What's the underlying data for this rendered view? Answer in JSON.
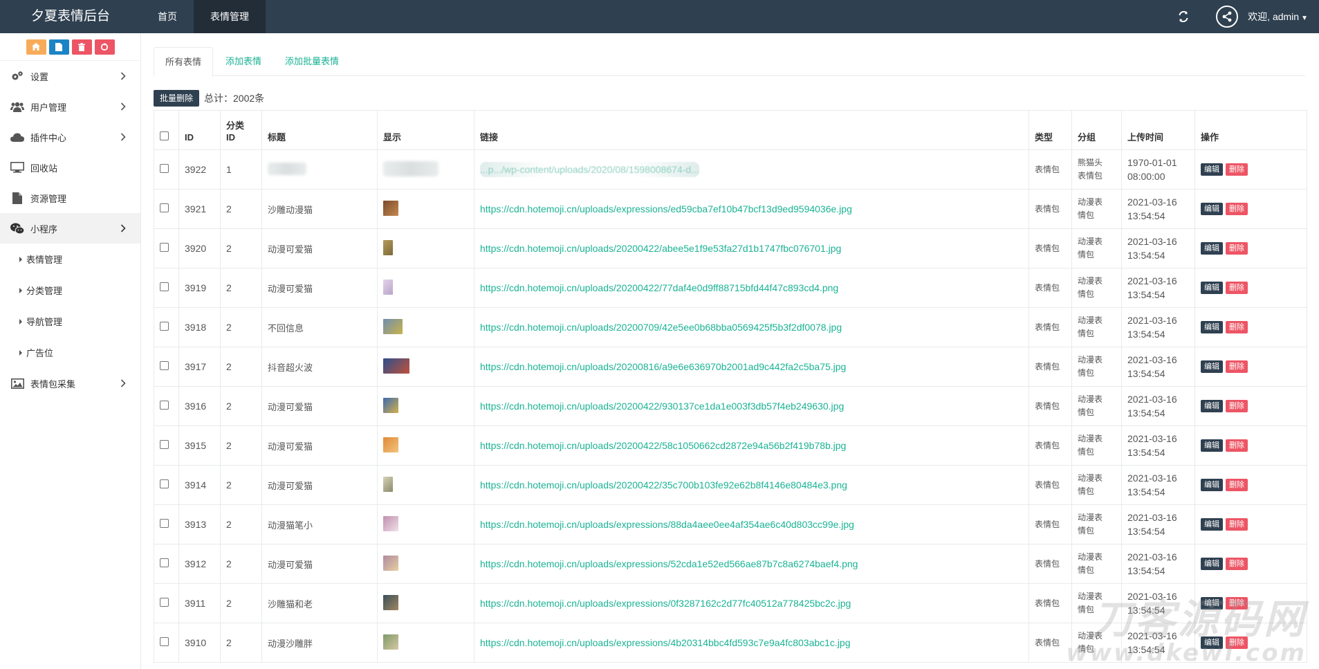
{
  "app": {
    "title": "夕夏表情后台"
  },
  "topnav": [
    {
      "label": "首页",
      "active": false
    },
    {
      "label": "表情管理",
      "active": true
    }
  ],
  "user": {
    "welcome": "欢迎, admin"
  },
  "quickbar": [
    {
      "icon": "home-icon",
      "color": "#f8ac59"
    },
    {
      "icon": "document-icon",
      "color": "#1c84c6"
    },
    {
      "icon": "trash-icon",
      "color": "#ed5565"
    },
    {
      "icon": "recycle-icon",
      "color": "#ed5565"
    }
  ],
  "sidebar": {
    "items": [
      {
        "label": "设置",
        "icon": "gears-icon"
      },
      {
        "label": "用户管理",
        "icon": "users-icon"
      },
      {
        "label": "插件中心",
        "icon": "cloud-icon"
      },
      {
        "label": "回收站",
        "icon": "monitor-icon"
      },
      {
        "label": "资源管理",
        "icon": "file-icon"
      },
      {
        "label": "小程序",
        "icon": "wechat-icon"
      }
    ],
    "subitems": [
      "表情管理",
      "分类管理",
      "导航管理",
      "广告位"
    ],
    "last_item": {
      "label": "表情包采集",
      "icon": "image-icon"
    }
  },
  "tabs": [
    "所有表情",
    "添加表情",
    "添加批量表情"
  ],
  "toolbar": {
    "bulk_delete": "批量删除",
    "total": "总计：2002条"
  },
  "table": {
    "headers": {
      "id": "ID",
      "cat_id_1": "分类",
      "cat_id_2": "ID",
      "title": "标题",
      "display": "显示",
      "link": "链接",
      "type": "类型",
      "group": "分组",
      "upload_time": "上传时间",
      "actions": "操作"
    },
    "edit_label": "编辑",
    "delete_label": "删除",
    "rows": [
      {
        "id": "3922",
        "cat": "1",
        "title": "",
        "link": "...p.../wp-content/uploads/2020/08/1598008674-d...",
        "type": "表情包",
        "group1": "熊猫头",
        "group2": "表情包",
        "date": "1970-01-01",
        "time": "08:00:00"
      },
      {
        "id": "3921",
        "cat": "2",
        "title": "沙雕动漫猫",
        "link": "https://cdn.hotemoji.cn/uploads/expressions/ed59cba7ef10b47bcf13d9ed9594036e.jpg",
        "type": "表情包",
        "group1": "动漫表",
        "group2": "情包",
        "date": "2021-03-16",
        "time": "13:54:54"
      },
      {
        "id": "3920",
        "cat": "2",
        "title": "动漫可爱猫",
        "link": "https://cdn.hotemoji.cn/uploads/20200422/abee5e1f9e53fa27d1b1747fbc076701.jpg",
        "type": "表情包",
        "group1": "动漫表",
        "group2": "情包",
        "date": "2021-03-16",
        "time": "13:54:54"
      },
      {
        "id": "3919",
        "cat": "2",
        "title": "动漫可爱猫",
        "link": "https://cdn.hotemoji.cn/uploads/20200422/77daf4e0d9ff88715bfd44f47c893cd4.png",
        "type": "表情包",
        "group1": "动漫表",
        "group2": "情包",
        "date": "2021-03-16",
        "time": "13:54:54"
      },
      {
        "id": "3918",
        "cat": "2",
        "title": "不回信息",
        "link": "https://cdn.hotemoji.cn/uploads/20200709/42e5ee0b68bba0569425f5b3f2df0078.jpg",
        "type": "表情包",
        "group1": "动漫表",
        "group2": "情包",
        "date": "2021-03-16",
        "time": "13:54:54"
      },
      {
        "id": "3917",
        "cat": "2",
        "title": "抖音超火波",
        "link": "https://cdn.hotemoji.cn/uploads/20200816/a9e6e636970b2001ad9c442fa2c5ba75.jpg",
        "type": "表情包",
        "group1": "动漫表",
        "group2": "情包",
        "date": "2021-03-16",
        "time": "13:54:54"
      },
      {
        "id": "3916",
        "cat": "2",
        "title": "动漫可爱猫",
        "link": "https://cdn.hotemoji.cn/uploads/20200422/930137ce1da1e003f3db57f4eb249630.jpg",
        "type": "表情包",
        "group1": "动漫表",
        "group2": "情包",
        "date": "2021-03-16",
        "time": "13:54:54"
      },
      {
        "id": "3915",
        "cat": "2",
        "title": "动漫可爱猫",
        "link": "https://cdn.hotemoji.cn/uploads/20200422/58c1050662cd2872e94a56b2f419b78b.jpg",
        "type": "表情包",
        "group1": "动漫表",
        "group2": "情包",
        "date": "2021-03-16",
        "time": "13:54:54"
      },
      {
        "id": "3914",
        "cat": "2",
        "title": "动漫可爱猫",
        "link": "https://cdn.hotemoji.cn/uploads/20200422/35c700b103fe92e62b8f4146e80484e3.png",
        "type": "表情包",
        "group1": "动漫表",
        "group2": "情包",
        "date": "2021-03-16",
        "time": "13:54:54"
      },
      {
        "id": "3913",
        "cat": "2",
        "title": "动漫猫笔小",
        "link": "https://cdn.hotemoji.cn/uploads/expressions/88da4aee0ee4af354ae6c40d803cc99e.jpg",
        "type": "表情包",
        "group1": "动漫表",
        "group2": "情包",
        "date": "2021-03-16",
        "time": "13:54:54"
      },
      {
        "id": "3912",
        "cat": "2",
        "title": "动漫可爱猫",
        "link": "https://cdn.hotemoji.cn/uploads/expressions/52cda1e52ed566ae87b7c8a6274baef4.png",
        "type": "表情包",
        "group1": "动漫表",
        "group2": "情包",
        "date": "2021-03-16",
        "time": "13:54:54"
      },
      {
        "id": "3911",
        "cat": "2",
        "title": "沙雕猫和老",
        "link": "https://cdn.hotemoji.cn/uploads/expressions/0f3287162c2d77fc40512a778425bc2c.jpg",
        "type": "表情包",
        "group1": "动漫表",
        "group2": "情包",
        "date": "2021-03-16",
        "time": "13:54:54"
      },
      {
        "id": "3910",
        "cat": "2",
        "title": "动漫沙雕胖",
        "link": "https://cdn.hotemoji.cn/uploads/expressions/4b20314bbc4fd593c7e9a4fc803abc1c.jpg",
        "type": "表情包",
        "group1": "动漫表",
        "group2": "情包",
        "date": "2021-03-16",
        "time": "13:54:54"
      }
    ],
    "thumb_colors": [
      [],
      [
        "#7a4a2a",
        "#c58a52"
      ],
      [
        "#b39a5a",
        "#7c6a3a"
      ],
      [
        "#e2d4e8",
        "#b9a4c9"
      ],
      [
        "#6f8fb0",
        "#c9b24a"
      ],
      [
        "#2c4f8c",
        "#c0503a"
      ],
      [
        "#3a6bb0",
        "#d6b04a"
      ],
      [
        "#e08a3a",
        "#f2c47a"
      ],
      [
        "#d8d2b8",
        "#8a8a6a"
      ],
      [
        "#c090b0",
        "#f0e0e8"
      ],
      [
        "#b08aa0",
        "#e6cfa0"
      ],
      [
        "#3a4f5a",
        "#a08660"
      ],
      [
        "#7f9a6a",
        "#d6c8a0"
      ]
    ]
  },
  "watermark": {
    "cn": "刀客源码网",
    "url": "www.dkewl.com"
  }
}
